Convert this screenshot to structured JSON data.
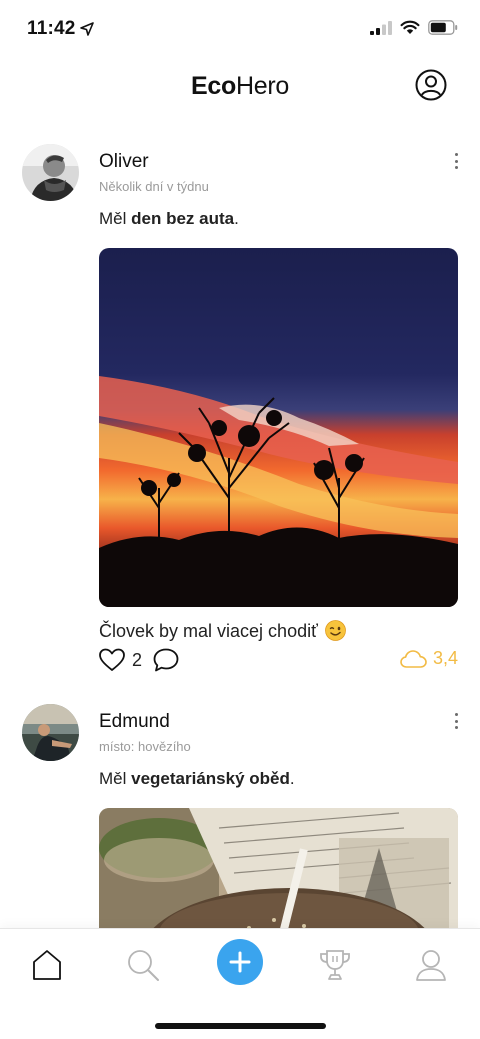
{
  "status_bar": {
    "time": "11:42"
  },
  "header": {
    "title_bold": "Eco",
    "title_light": "Hero"
  },
  "posts": [
    {
      "author": "Oliver",
      "subline": "Několik dní v týdnu",
      "action_prefix": "Měl ",
      "action_bold": "den bez auta",
      "action_suffix": ".",
      "caption": "Človek by mal viacej chodiť",
      "caption_emoji": "winking-face",
      "likes": "2",
      "co2": "3,4"
    },
    {
      "author": "Edmund",
      "subline": "místo: hovězího",
      "action_prefix": "Měl ",
      "action_bold": "vegetariánský oběd",
      "action_suffix": "."
    }
  ],
  "nav": {
    "items": [
      "home-icon",
      "search-icon",
      "add-icon",
      "trophy-icon",
      "profile-icon"
    ],
    "accent": "#3aa4ee"
  },
  "colors": {
    "co2": "#f2bb45",
    "muted": "#9a9a9a"
  }
}
